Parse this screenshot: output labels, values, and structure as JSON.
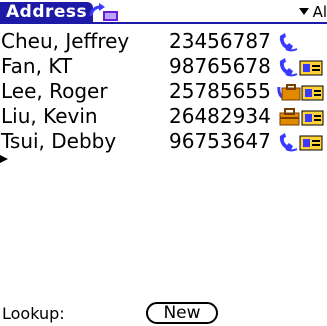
{
  "title": "Address",
  "category": "Al",
  "contacts": [
    {
      "name": "Cheu, Jeffrey",
      "phone": "23456787",
      "icon": "phone-handset-icon"
    },
    {
      "name": "Fan, KT",
      "phone": "98765678",
      "icon": "phone-contact-card-icon"
    },
    {
      "name": "Lee, Roger",
      "phone": "25785655",
      "icon": "work-briefcase-contact-card-icon"
    },
    {
      "name": "Liu, Kevin",
      "phone": "26482934",
      "icon": "briefcase-contact-card-icon"
    },
    {
      "name": "Tsui, Debby",
      "phone": "96753647",
      "icon": "phone-contact-card-icon"
    }
  ],
  "lookup_label": "Lookup:",
  "new_button_label": "New",
  "colors": {
    "title_bar": "#1e1aa8",
    "icon_blue": "#3a3aff",
    "icon_orange": "#e08a00",
    "icon_yellow": "#ffd23a",
    "icon_brown": "#7a3b00"
  }
}
